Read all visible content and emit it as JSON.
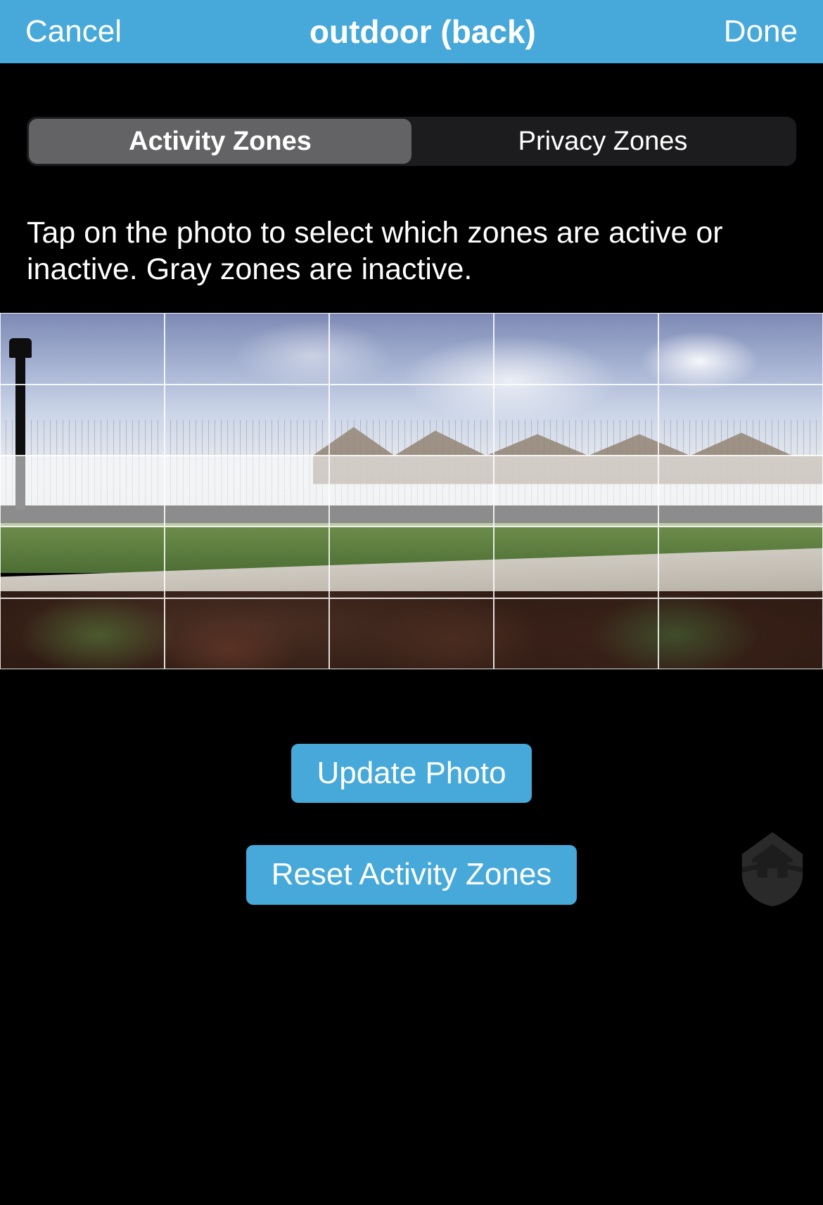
{
  "navbar": {
    "cancel": "Cancel",
    "title": "outdoor (back)",
    "done": "Done"
  },
  "tabs": {
    "activity": "Activity Zones",
    "privacy": "Privacy Zones",
    "selected": "activity"
  },
  "instructions": "Tap on the photo to select which zones are active or inactive. Gray zones are inactive.",
  "grid": {
    "rows": 5,
    "cols": 5,
    "inactive_rows": [
      2
    ]
  },
  "buttons": {
    "update_photo": "Update Photo",
    "reset_zones": "Reset Activity Zones"
  },
  "colors": {
    "accent": "#46a9da",
    "background": "#000000",
    "segment_bg": "#1c1c1e",
    "segment_active": "#636366"
  },
  "watermark_icon": "house-shield-icon"
}
